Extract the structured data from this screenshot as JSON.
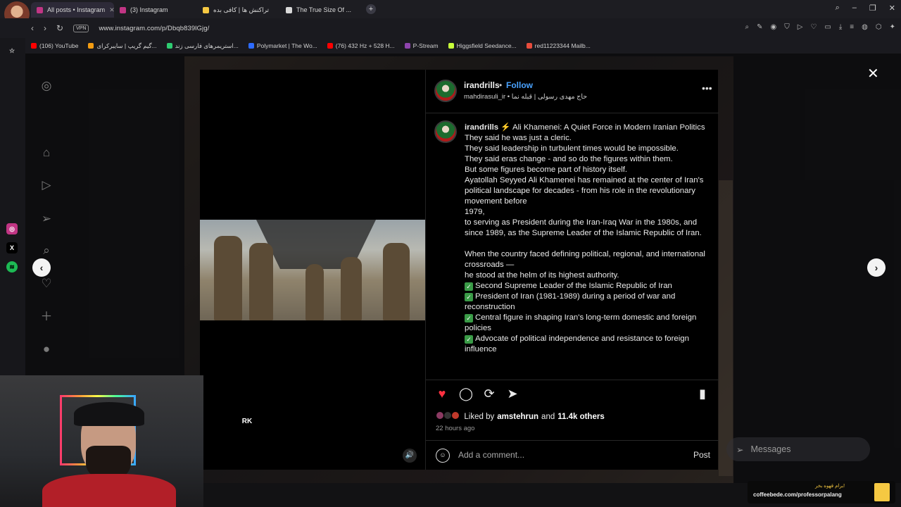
{
  "browser": {
    "tabs": [
      {
        "title": "All posts • Instagram",
        "color": "#c13584",
        "active": true
      },
      {
        "title": "(3) Instagram",
        "color": "#c13584",
        "active": false
      },
      {
        "title": "تراکنش ها | کافی بده",
        "color": "#f5c842",
        "active": false
      },
      {
        "title": "The True Size Of ...",
        "color": "#d9d9d9",
        "active": false
      }
    ],
    "new_tab": "+",
    "vpn": "VPN",
    "url": "www.instagram.com/p/Dbqb839lGjg/",
    "bookmarks": [
      {
        "label": "(106) YouTube",
        "color": "#ff0000"
      },
      {
        "label": "گیم گریپ | سایبرکرای...",
        "color": "#f39c12"
      },
      {
        "label": "استریمرهای فارسی زند...",
        "color": "#2ecc71"
      },
      {
        "label": "Polymarket | The Wo...",
        "color": "#2d6bff"
      },
      {
        "label": "(76) 432 Hz + 528 H...",
        "color": "#ff0000"
      },
      {
        "label": "P-Stream",
        "color": "#8e44ad"
      },
      {
        "label": "Higgsfield Seedance...",
        "color": "#c8ff3a"
      },
      {
        "label": "red11223344 Mailb...",
        "color": "#e74c3c"
      }
    ]
  },
  "post": {
    "author": "irandrills",
    "follow": "Follow",
    "dot": "•",
    "subline": "mahdirasuli_ir • حاج مهدی رسولی | قبله نما",
    "caption_author": "irandrills",
    "caption_lines": [
      "⚡ Ali Khamenei: A Quiet Force in Modern Iranian Politics",
      "They said he was just a cleric.",
      "They said leadership in turbulent times would be impossible.",
      "They said eras change - and so do the figures within them.",
      "But some figures become part of history itself.",
      "Ayatollah Seyyed Ali Khamenei has remained at the center of Iran's political landscape for decades - from his role in the revolutionary movement before",
      "1979,",
      "to serving as President during the Iran-Iraq War in the 1980s, and since 1989, as the Supreme Leader of the Islamic Republic of Iran.",
      "",
      "When the country faced defining political, regional, and international crossroads —",
      "he stood at the helm of its highest authority."
    ],
    "bullets": [
      "Second Supreme Leader of the Islamic Republic of Iran",
      "President of Iran (1981-1989) during a period of war and reconstruction",
      "Central figure in shaping Iran's long-term domestic and foreign policies",
      "Advocate of political independence and resistance to foreign influence"
    ],
    "liked_by_prefix": "Liked by",
    "liked_by_user": "amstehrun",
    "liked_by_and": "and",
    "liked_by_others": "11.4k others",
    "time_ago": "22 hours ago",
    "comment_placeholder": "Add a comment...",
    "post_label": "Post",
    "watermark": "RK"
  },
  "messages": {
    "label": "Messages"
  },
  "promo": {
    "line1": "برام قهوه بخر!",
    "line2": "coffeebede.com/professorpalang"
  },
  "accent_colors": {
    "like": "#ff3040",
    "follow": "#4aa3ff"
  }
}
